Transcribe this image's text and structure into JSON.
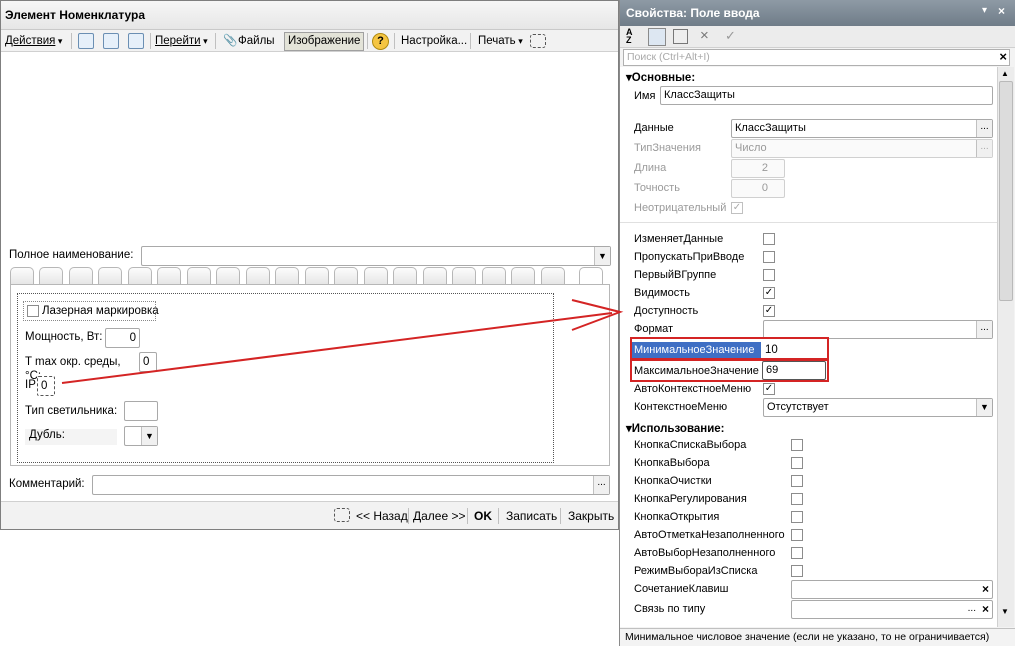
{
  "left": {
    "title": "Элемент Номенклатура",
    "toolbar": {
      "actions": "Действия",
      "goto": "Перейти",
      "files": "Файлы",
      "image": "Изображение",
      "settings": "Настройка...",
      "print": "Печать"
    },
    "full_name_label": "Полное наименование:",
    "laser_label": "Лазерная маркировка",
    "power_label": "Мощность, Вт:",
    "power_value": "0",
    "tmax_label": "T max окр. среды, °C:",
    "tmax_value": "0",
    "ip_label": "IP",
    "ip_value": "0",
    "lamp_type_label": "Тип светильника:",
    "dubl_label": "Дубль:",
    "comment_label": "Комментарий:",
    "footer": {
      "back": "<< Назад",
      "next": "Далее >>",
      "ok": "OK",
      "write": "Записать",
      "close": "Закрыть"
    }
  },
  "right": {
    "title": "Свойства: Поле ввода",
    "search_placeholder": "Поиск (Ctrl+Alt+I)",
    "section_main": "Основные:",
    "name_label": "Имя",
    "name_value": "КлассЗащиты",
    "data_label": "Данные",
    "data_value": "КлассЗащиты",
    "type_label": "ТипЗначения",
    "type_value": "Число",
    "length_label": "Длина",
    "length_value": "2",
    "precision_label": "Точность",
    "precision_value": "0",
    "nonneg_label": "Неотрицательный",
    "changes_data": "ИзменяетДанные",
    "skip_input": "ПропускатьПриВводе",
    "first_in_group": "ПервыйВГруппе",
    "visibility": "Видимость",
    "accessibility": "Доступность",
    "format_label": "Формат",
    "min_label": "МинимальноеЗначение",
    "min_value": "10",
    "max_label": "МаксимальноеЗначение",
    "max_value": "69",
    "auto_ctx_menu": "АвтоКонтекстноеМеню",
    "ctx_menu_label": "КонтекстноеМеню",
    "ctx_menu_value": "Отсутствует",
    "section_usage": "Использование:",
    "btn_list": "КнопкаСпискаВыбора",
    "btn_choice": "КнопкаВыбора",
    "btn_clear": "КнопкаОчистки",
    "btn_regulate": "КнопкаРегулирования",
    "btn_open": "КнопкаОткрытия",
    "auto_mark": "АвтоОтметкаНезаполненного",
    "auto_choice": "АвтоВыборНезаполненного",
    "choice_mode": "РежимВыбораИзСписка",
    "shortcut_label": "СочетаниеКлавиш",
    "type_link_label": "Связь по типу",
    "status": "Минимальное числовое значение (если не указано, то не ограничивается)"
  }
}
